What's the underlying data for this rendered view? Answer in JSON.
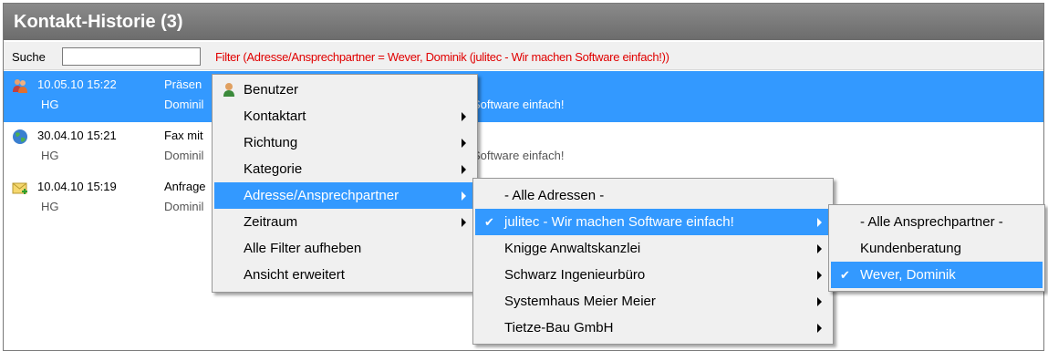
{
  "panel": {
    "title": "Kontakt-Historie (3)"
  },
  "search": {
    "label": "Suche",
    "value": "",
    "filter_text": "Filter (Adresse/Ansprechpartner = Wever, Dominik (julitec - Wir machen Software einfach!))"
  },
  "rows": [
    {
      "date": "10.05.10 15:22",
      "user": "HG",
      "subject": "Präsen",
      "subject2": "Dominil",
      "company": "Software einfach!",
      "icon": "meeting-icon",
      "selected": true
    },
    {
      "date": "30.04.10 15:21",
      "user": "HG",
      "subject": "Fax mit",
      "subject2": "Dominil",
      "company": "Software einfach!",
      "icon": "globe-icon",
      "selected": false
    },
    {
      "date": "10.04.10 15:19",
      "user": "HG",
      "subject": "Anfrage",
      "subject2": "Dominil",
      "company": "",
      "icon": "envelope-icon",
      "selected": false
    }
  ],
  "context_menu": {
    "items": [
      {
        "label": "Benutzer",
        "icon": "user-icon"
      },
      {
        "label": "Kontaktart"
      },
      {
        "label": "Richtung"
      },
      {
        "label": "Kategorie"
      },
      {
        "label": "Adresse/Ansprechpartner"
      },
      {
        "label": "Zeitraum"
      },
      {
        "label": "Alle Filter aufheben"
      },
      {
        "label": "Ansicht erweitert"
      }
    ]
  },
  "address_menu": {
    "items": [
      {
        "label": "- Alle Adressen -"
      },
      {
        "label": "julitec - Wir machen Software einfach!",
        "checked": true
      },
      {
        "label": "Knigge Anwaltskanzlei"
      },
      {
        "label": "Schwarz Ingenieurbüro"
      },
      {
        "label": "Systemhaus Meier  Meier"
      },
      {
        "label": "Tietze-Bau GmbH"
      }
    ]
  },
  "contact_menu": {
    "items": [
      {
        "label": "- Alle Ansprechpartner -"
      },
      {
        "label": "Kundenberatung"
      },
      {
        "label": "Wever, Dominik",
        "checked": true
      }
    ]
  },
  "colors": {
    "selection": "#3399ff",
    "filter_text": "#e00000",
    "titlebar": "#777777"
  }
}
